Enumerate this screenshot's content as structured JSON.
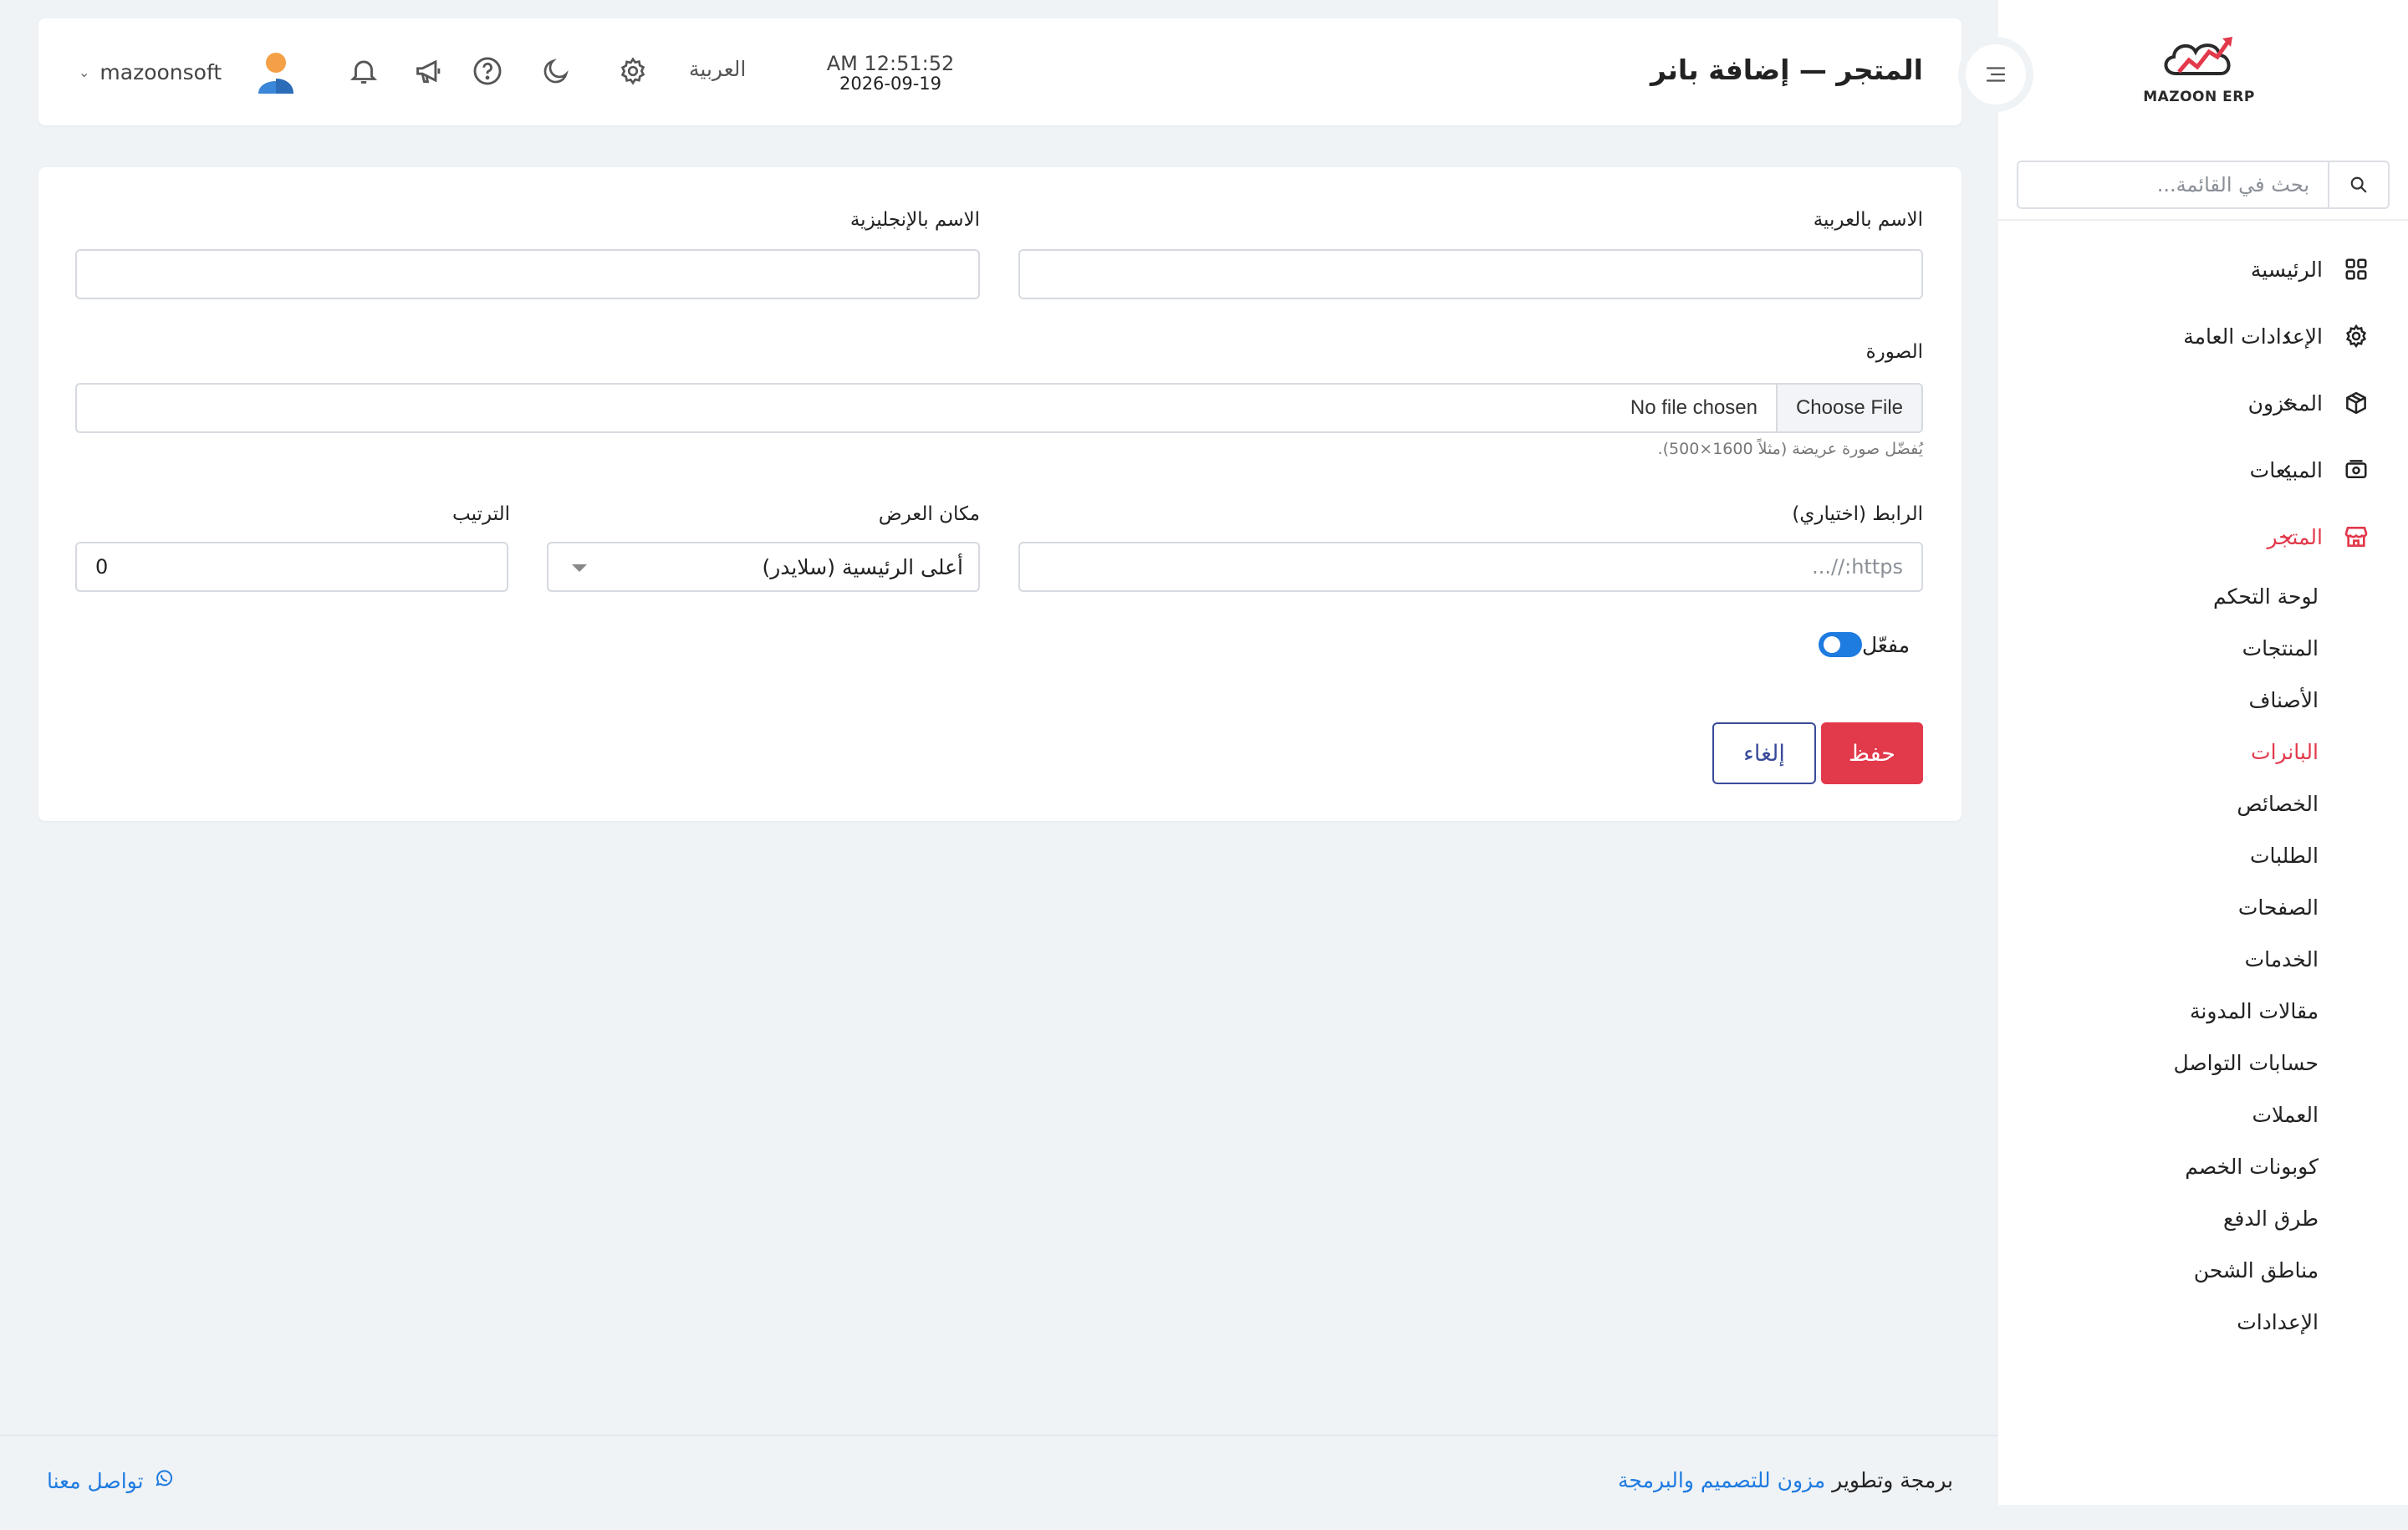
{
  "sidebar": {
    "logo_text": "MAZOON ERP",
    "search_placeholder": "بحث في القائمة...",
    "items": [
      {
        "label": "الرئيسية",
        "icon": "grid-icon"
      },
      {
        "label": "الإعدادات العامة",
        "icon": "gear-icon"
      },
      {
        "label": "المخزون",
        "icon": "box-icon"
      },
      {
        "label": "المبيعات",
        "icon": "cash-icon"
      },
      {
        "label": "المتجر",
        "icon": "store-icon"
      }
    ],
    "store_sub": [
      "لوحة التحكم",
      "المنتجات",
      "الأصناف",
      "البانرات",
      "الخصائص",
      "الطلبات",
      "الصفحات",
      "الخدمات",
      "مقالات المدونة",
      "حسابات التواصل",
      "العملات",
      "كوبونات الخصم",
      "طرق الدفع",
      "مناطق الشحن",
      "الإعدادات"
    ],
    "active_sub": "البانرات"
  },
  "header": {
    "title": "المتجر — إضافة بانر",
    "time": "AM 12:51:52",
    "date": "2026-09-19",
    "language": "العربية",
    "username": "mazoonsoft"
  },
  "form": {
    "name_ar_label": "الاسم بالعربية",
    "name_ar_value": "",
    "name_en_label": "الاسم بالإنجليزية",
    "name_en_value": "",
    "image_label": "الصورة",
    "file_button": "Choose File",
    "file_status": "No file chosen",
    "image_hint": "يُفضّل صورة عريضة (مثلاً 1600×500).",
    "link_label": "الرابط (اختياري)",
    "link_placeholder": "https://...",
    "placement_label": "مكان العرض",
    "placement_value": "أعلى الرئيسية (سلايدر)",
    "order_label": "الترتيب",
    "order_value": "0",
    "active_label": "مفعّل",
    "active_on": true,
    "save_label": "حفظ",
    "cancel_label": "إلغاء"
  },
  "footer": {
    "credit_prefix": "برمجة وتطوير",
    "credit_brand": "مزون للتصميم والبرمجة",
    "contact": "تواصل معنا"
  },
  "colors": {
    "accent_red": "#e2394b",
    "link_blue": "#1e7be0",
    "cancel_blue": "#3a4b9a",
    "background": "#f0f3f6"
  }
}
